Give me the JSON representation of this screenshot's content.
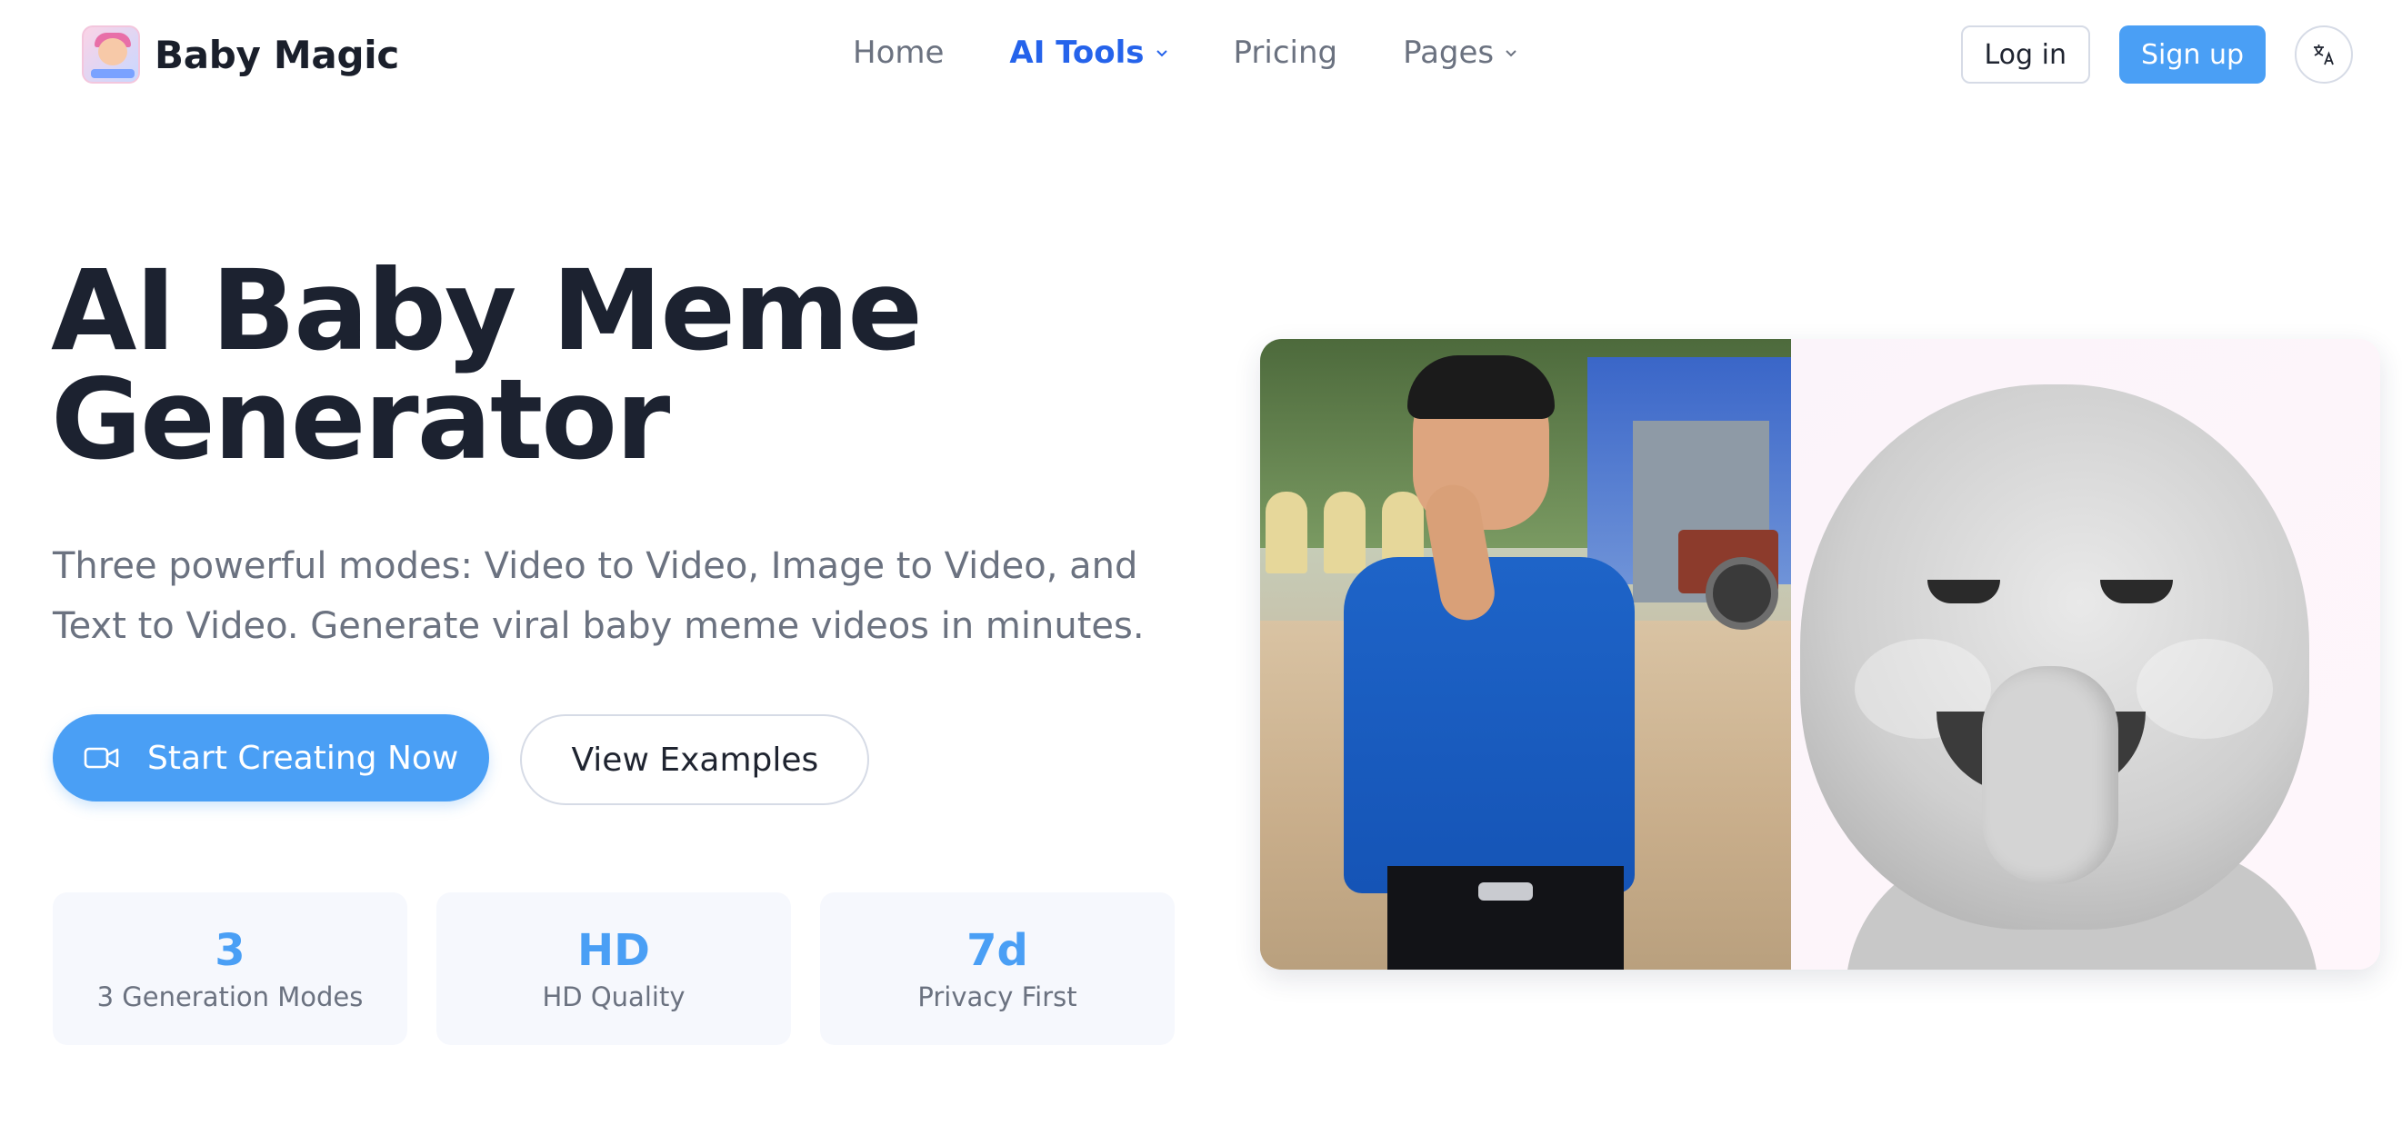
{
  "brand": {
    "name": "Baby Magic"
  },
  "nav": {
    "items": [
      {
        "label": "Home",
        "active": false,
        "dropdown": false
      },
      {
        "label": "AI Tools",
        "active": true,
        "dropdown": true
      },
      {
        "label": "Pricing",
        "active": false,
        "dropdown": false
      },
      {
        "label": "Pages",
        "active": false,
        "dropdown": true
      }
    ],
    "login": "Log in",
    "signup": "Sign up",
    "language_icon": "translate-icon"
  },
  "hero": {
    "title_line1": "AI Baby Meme",
    "title_line2": "Generator",
    "subtitle": "Three powerful modes: Video to Video, Image to Video, and Text to Video. Generate viral baby meme videos in minutes.",
    "primary_cta": "Start Creating Now",
    "primary_icon": "video-camera-icon",
    "secondary_cta": "View Examples"
  },
  "stats": [
    {
      "value": "3",
      "label": "3 Generation Modes"
    },
    {
      "value": "HD",
      "label": "HD Quality"
    },
    {
      "value": "7d",
      "label": "Privacy First"
    }
  ],
  "colors": {
    "accent": "#4a9ff5",
    "nav_active": "#2563eb",
    "heading": "#1c2230",
    "muted": "#6b7280"
  }
}
